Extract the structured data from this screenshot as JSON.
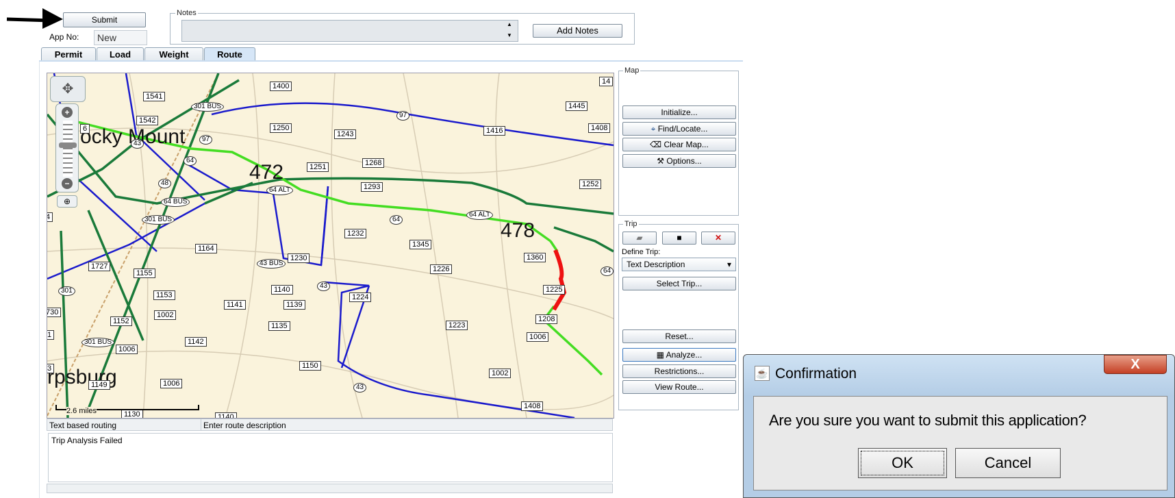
{
  "top": {
    "submit_label": "Submit",
    "app_no_label": "App No:",
    "app_no_value": "New",
    "notes_legend": "Notes",
    "add_notes_label": "Add Notes"
  },
  "tabs": [
    {
      "label": "Permit",
      "active": false
    },
    {
      "label": "Load",
      "active": false
    },
    {
      "label": "Weight",
      "active": false
    },
    {
      "label": "Route",
      "active": true
    }
  ],
  "map": {
    "scale_text": "2.6 miles",
    "place_names": [
      "ocky Mount",
      "rpsburg"
    ],
    "big_labels": [
      "472",
      "478"
    ],
    "road_labels": [
      "1541",
      "1400",
      "1445",
      "1542",
      "1250",
      "1243",
      "1416",
      "1408",
      "1251",
      "1268",
      "1293",
      "1252",
      "1232",
      "1345",
      "1164",
      "1230",
      "1727",
      "1155",
      "1226",
      "1360",
      "1225",
      "1153",
      "1140",
      "1224",
      "1141",
      "1139",
      "1002",
      "1152",
      "1135",
      "1223",
      "1208",
      "1142",
      "1006",
      "1006",
      "1150",
      "1149",
      "1006",
      "1002",
      "1130",
      "1408",
      "1140",
      "730",
      "1",
      "3",
      "4",
      "6",
      "14"
    ],
    "route_shields": [
      "301 BUS",
      "97",
      "97",
      "43",
      "64",
      "48",
      "64 ALT",
      "64 BUS",
      "301 BUS",
      "64",
      "64 ALT",
      "43 BUS",
      "43",
      "301",
      "301 BUS",
      "43",
      "64"
    ]
  },
  "map_panel": {
    "legend": "Map",
    "buttons": [
      "Initialize...",
      "Find/Locate...",
      "Clear Map...",
      "Options..."
    ]
  },
  "trip_panel": {
    "legend": "Trip",
    "define_trip_label": "Define Trip:",
    "define_trip_value": "Text Description",
    "select_trip_label": "Select Trip...",
    "buttons": [
      "Reset...",
      "Analyze...",
      "Restrictions...",
      "View Route..."
    ]
  },
  "bottom": {
    "routing_label": "Text based routing",
    "route_desc_placeholder": "Enter route description",
    "status_text": "Trip Analysis Failed"
  },
  "dialog": {
    "title": "Confirmation",
    "message": "Are you sure you want to submit this application?",
    "ok_label": "OK",
    "cancel_label": "Cancel",
    "close_glyph": "X"
  },
  "colors": {
    "route_green": "#44dd22",
    "route_red": "#ee1111",
    "highway_green": "#1a7a3a",
    "road_blue": "#1a1acc",
    "map_bg": "#faf3dc"
  }
}
